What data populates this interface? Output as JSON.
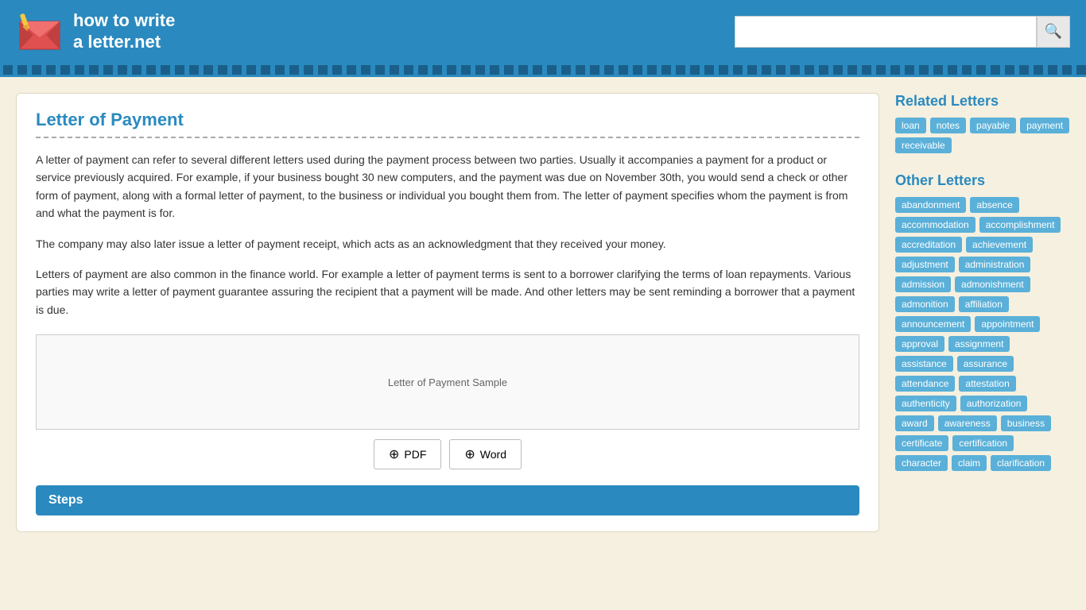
{
  "header": {
    "logo_line1": "how to write",
    "logo_line2": "a letter.net",
    "search_placeholder": "",
    "search_btn_icon": "🔍"
  },
  "content": {
    "title": "Letter of Payment",
    "paragraphs": [
      "A letter of payment can refer to several different letters used during the payment process between two parties. Usually it accompanies a payment for a product or service previously acquired. For example, if your business bought 30 new computers, and the payment was due on November 30th, you would send a check or other form of payment, along with a formal letter of payment, to the business or individual you bought them from. The letter of payment specifies whom the payment is from and what the payment is for.",
      "The company may also later issue a letter of payment receipt, which acts as an acknowledgment that they received your money.",
      "Letters of payment are also common in the finance world. For example a letter of payment terms is sent to a borrower clarifying the terms of loan repayments. Various parties may write a letter of payment guarantee assuring the recipient that a payment will be made. And other letters may be sent reminding a borrower that a payment is due."
    ],
    "sample_image_alt": "Letter of Payment Sample",
    "pdf_label": "PDF",
    "word_label": "Word",
    "steps_label": "Steps"
  },
  "sidebar": {
    "related_title": "Related Letters",
    "related_tags": [
      "loan",
      "notes",
      "payable",
      "payment",
      "receivable"
    ],
    "other_title": "Other Letters",
    "other_tags": [
      "abandonment",
      "absence",
      "accommodation",
      "accomplishment",
      "accreditation",
      "achievement",
      "adjustment",
      "administration",
      "admission",
      "admonishment",
      "admonition",
      "affiliation",
      "announcement",
      "appointment",
      "approval",
      "assignment",
      "assistance",
      "assurance",
      "attendance",
      "attestation",
      "authenticity",
      "authorization",
      "award",
      "awareness",
      "business",
      "certificate",
      "certification",
      "character",
      "claim",
      "clarification"
    ]
  }
}
